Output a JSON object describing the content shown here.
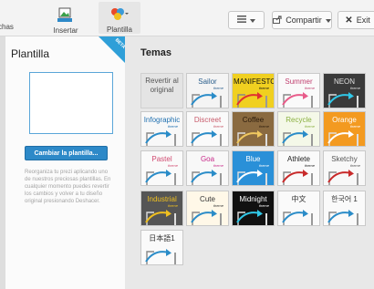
{
  "toolbar": {
    "fechas_label": "chas",
    "insertar_label": "Insertar",
    "plantilla_label": "Plantilla",
    "menu_icon": "menu-icon",
    "compartir_label": "Compartir",
    "exit_label": "Exit"
  },
  "left_panel": {
    "title": "Plantilla",
    "beta_badge": "BETA",
    "change_button": "Cambiar la plantilla...",
    "description": "Reorganiza tu prezi aplicando uno de nuestros preciosas plantillas. En cualquier momento puedes revertir los cambios y volver a tu diseño original presionando Deshacer."
  },
  "themes_title": "Temas",
  "themes": [
    {
      "name": "Revertir al original",
      "sub": "",
      "bg": "#e4e4e4",
      "fg": "#555555",
      "accent": "#1e90d0",
      "dark": false
    },
    {
      "name": "Sailor",
      "sub": "theme",
      "bg": "#f4f4f4",
      "fg": "#2a5e8c",
      "accent": "#2a8cc8",
      "dark": false
    },
    {
      "name": "MANIFESTO",
      "sub": "theme",
      "bg": "#f0d020",
      "fg": "#111111",
      "accent": "#e03030",
      "dark": false
    },
    {
      "name": "Summer",
      "sub": "theme",
      "bg": "#fafafa",
      "fg": "#c04070",
      "accent": "#e85c8a",
      "dark": false
    },
    {
      "name": "NEON",
      "sub": "theme",
      "bg": "#3a3a3a",
      "fg": "#e0e0e0",
      "accent": "#30c8e8",
      "dark": true
    },
    {
      "name": "Infographic",
      "sub": "theme",
      "bg": "#f8f8f8",
      "fg": "#2070b0",
      "accent": "#2a8cc8",
      "dark": false
    },
    {
      "name": "Discreet",
      "sub": "theme",
      "bg": "#fafafa",
      "fg": "#c85a6a",
      "accent": "#2a8cc8",
      "dark": false
    },
    {
      "name": "Coffee",
      "sub": "theme",
      "bg": "#8a6a40",
      "fg": "#2a1a0a",
      "accent": "#f0c860",
      "dark": true
    },
    {
      "name": "Recycle",
      "sub": "theme",
      "bg": "#f4f8e8",
      "fg": "#8ab040",
      "accent": "#2a8cc8",
      "dark": false
    },
    {
      "name": "Orange",
      "sub": "theme",
      "bg": "#f39a20",
      "fg": "#ffffff",
      "accent": "#ffffff",
      "dark": true
    },
    {
      "name": "Pastel",
      "sub": "theme",
      "bg": "#fafafa",
      "fg": "#d04a70",
      "accent": "#2a8cc8",
      "dark": false
    },
    {
      "name": "Goa",
      "sub": "theme",
      "bg": "#f8f8f8",
      "fg": "#c82a8a",
      "accent": "#2a8cc8",
      "dark": false
    },
    {
      "name": "Blue",
      "sub": "theme",
      "bg": "#2a90d8",
      "fg": "#ffffff",
      "accent": "#ffffff",
      "dark": true
    },
    {
      "name": "Athlete",
      "sub": "theme",
      "bg": "#fafafa",
      "fg": "#222222",
      "accent": "#c82a2a",
      "dark": false
    },
    {
      "name": "Sketchy",
      "sub": "theme",
      "bg": "#f8f8f8",
      "fg": "#555555",
      "accent": "#c82a2a",
      "dark": false
    },
    {
      "name": "Industrial",
      "sub": "theme",
      "bg": "#555555",
      "fg": "#f0c020",
      "accent": "#f0c020",
      "dark": true
    },
    {
      "name": "Cute",
      "sub": "theme",
      "bg": "#fff8e8",
      "fg": "#333333",
      "accent": "#2a8cc8",
      "dark": false
    },
    {
      "name": "Midnight",
      "sub": "theme",
      "bg": "#111111",
      "fg": "#ffffff",
      "accent": "#30c8e8",
      "dark": true
    },
    {
      "name": "中文",
      "sub": "",
      "bg": "#fafafa",
      "fg": "#333333",
      "accent": "#2a8cc8",
      "dark": false
    },
    {
      "name": "한국어 1",
      "sub": "",
      "bg": "#fafafa",
      "fg": "#333333",
      "accent": "#2a8cc8",
      "dark": false
    },
    {
      "name": "日本語1",
      "sub": "",
      "bg": "#fafafa",
      "fg": "#333333",
      "accent": "#2a8cc8",
      "dark": false
    }
  ]
}
